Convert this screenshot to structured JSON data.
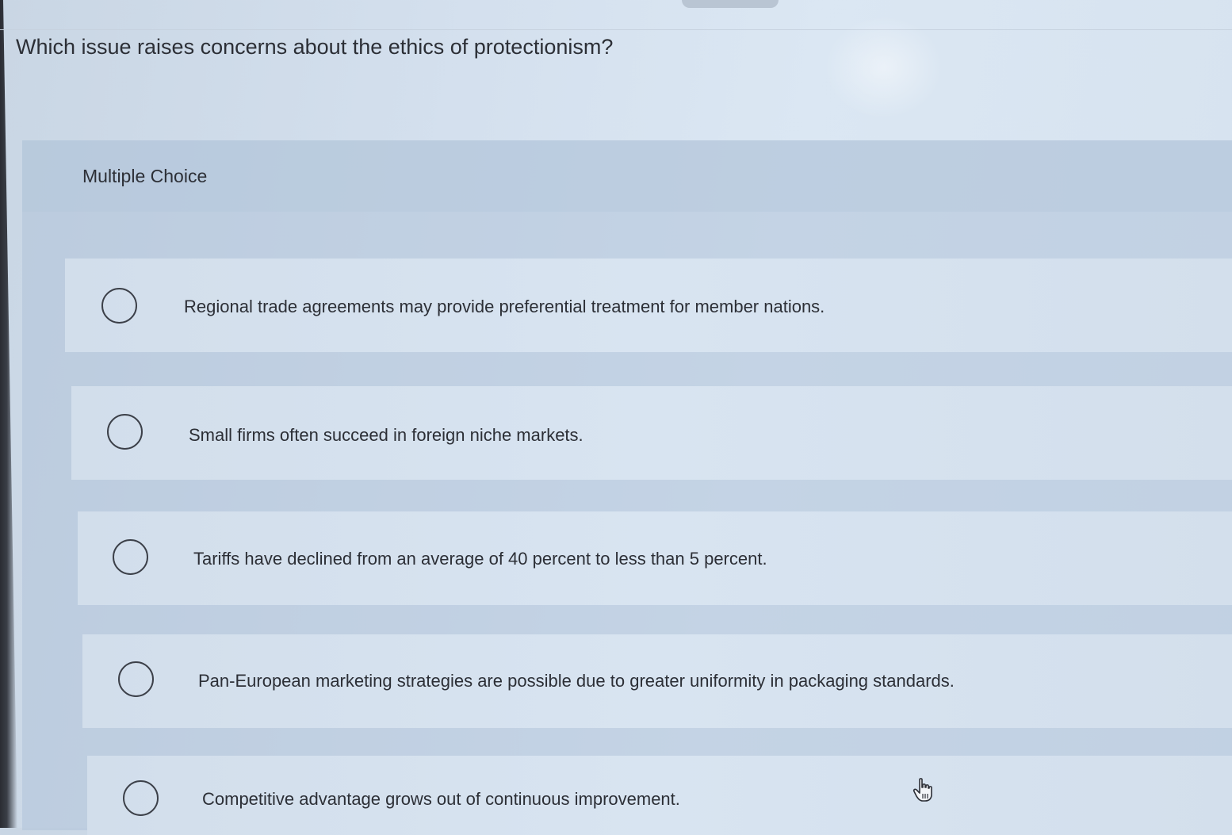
{
  "question": {
    "text": "Which issue raises concerns about the ethics of protectionism?"
  },
  "section": {
    "label": "Multiple Choice"
  },
  "options": [
    {
      "label": "Regional trade agreements may provide preferential treatment for member nations.",
      "selected": false
    },
    {
      "label": "Small firms often succeed in foreign niche markets.",
      "selected": false
    },
    {
      "label": "Tariffs have declined from an average of 40 percent to less than 5 percent.",
      "selected": false
    },
    {
      "label": "Pan-European marketing strategies are possible due to greater uniformity in packaging standards.",
      "selected": false
    },
    {
      "label": "Competitive advantage grows out of continuous improvement.",
      "selected": false
    }
  ],
  "cursor": {
    "icon": "hand-pointer-icon"
  }
}
